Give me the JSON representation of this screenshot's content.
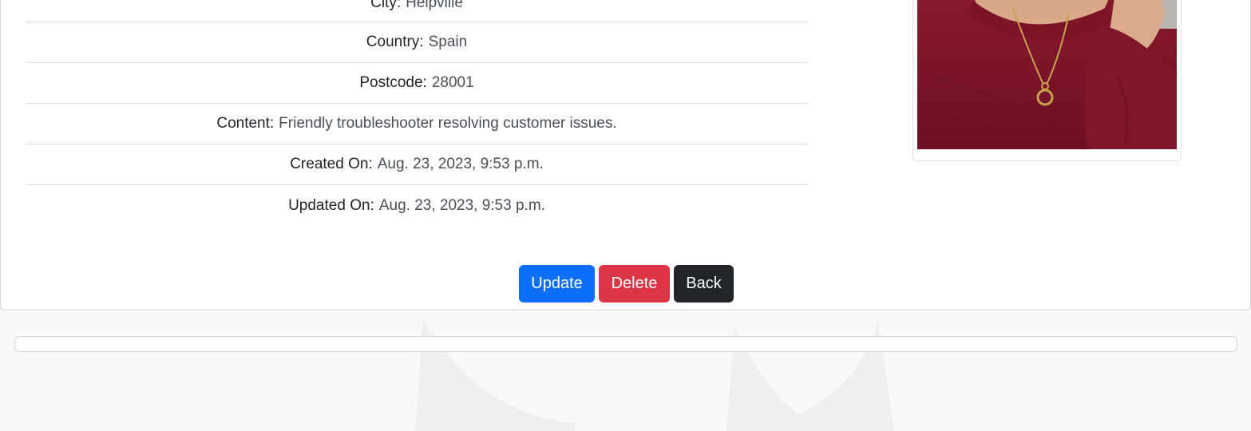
{
  "details": [
    {
      "label": "City:",
      "value": "Helpville"
    },
    {
      "label": "Country:",
      "value": "Spain"
    },
    {
      "label": "Postcode:",
      "value": "28001"
    },
    {
      "label": "Content:",
      "value": "Friendly troubleshooter resolving customer issues."
    },
    {
      "label": "Created On:",
      "value": "Aug. 23, 2023, 9:53 p.m."
    },
    {
      "label": "Updated On:",
      "value": "Aug. 23, 2023, 9:53 p.m."
    }
  ],
  "actions": {
    "update_label": "Update",
    "delete_label": "Delete",
    "back_label": "Back"
  },
  "colors": {
    "update": "#0d6efd",
    "delete": "#dc3545",
    "back": "#212529",
    "photo_shirt": "#7a1326"
  },
  "photo": {
    "icon": "profile-photo"
  }
}
